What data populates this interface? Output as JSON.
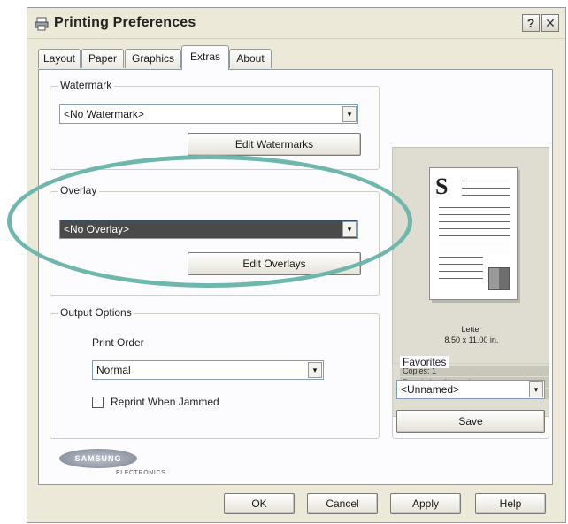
{
  "window": {
    "title": "Printing Preferences",
    "help_glyph": "?",
    "close_glyph": "✕"
  },
  "tabs": [
    {
      "label": "Layout"
    },
    {
      "label": "Paper"
    },
    {
      "label": "Graphics"
    },
    {
      "label": "Extras",
      "active": true
    },
    {
      "label": "About"
    }
  ],
  "watermark": {
    "group_label": "Watermark",
    "selected": "<No Watermark>",
    "edit_button": "Edit Watermarks"
  },
  "overlay": {
    "group_label": "Overlay",
    "selected": "<No Overlay>",
    "edit_button": "Edit Overlays"
  },
  "output": {
    "group_label": "Output Options",
    "print_order_label": "Print Order",
    "print_order_value": "Normal",
    "reprint_label": "Reprint When Jammed",
    "reprint_checked": false
  },
  "preview": {
    "paper_letter": "S",
    "paper_name": "Letter",
    "paper_size": "8.50 x 11.00 in.",
    "copies": "Copies: 1",
    "resolution": "Resolution: Normal",
    "color": "Color: Auto"
  },
  "favorites": {
    "group_label": "Favorites",
    "selected": "<Unnamed>",
    "save_button": "Save"
  },
  "brand": {
    "name": "SAMSUNG",
    "sub": "ELECTRONICS"
  },
  "footer": {
    "ok": "OK",
    "cancel": "Cancel",
    "apply": "Apply",
    "help": "Help"
  },
  "colors": {
    "annotation": "#6eb7ad",
    "dialog_bg": "#ece9d8",
    "panel_bg": "#fcfcfe"
  },
  "icons": {
    "dropdown": "▾",
    "title_icon": "printer-icon"
  }
}
